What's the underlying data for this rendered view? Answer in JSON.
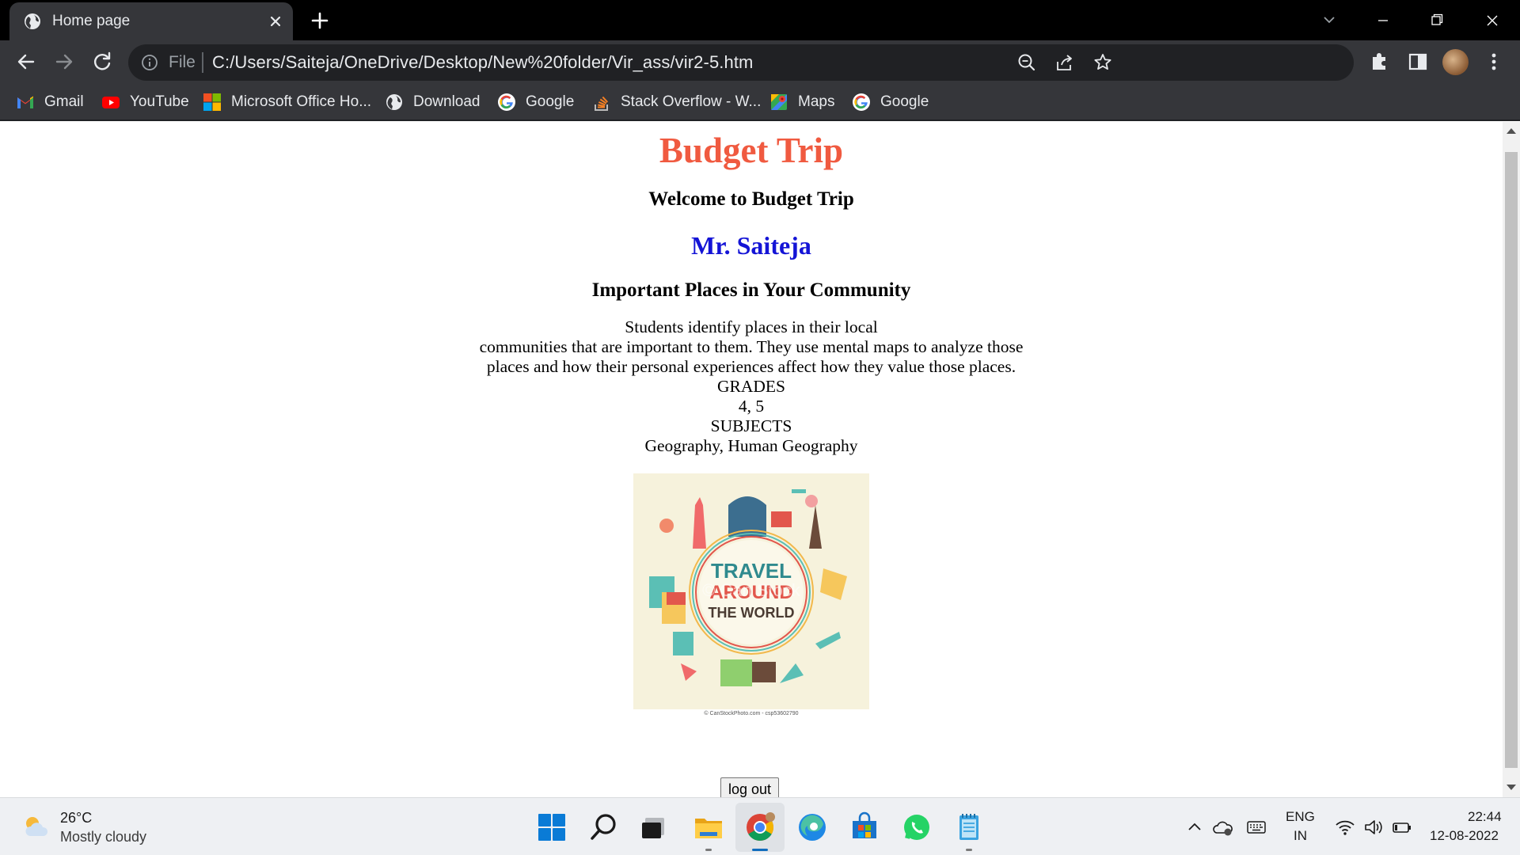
{
  "browser": {
    "tab_title": "Home page",
    "omnibox_scheme": "File",
    "url": "C:/Users/Saiteja/OneDrive/Desktop/New%20folder/Vir_ass/vir2-5.htm",
    "bookmarks": [
      {
        "label": "Gmail",
        "icon": "gmail-icon"
      },
      {
        "label": "YouTube",
        "icon": "youtube-icon"
      },
      {
        "label": "Microsoft Office Ho...",
        "icon": "microsoft-office-icon"
      },
      {
        "label": "Download",
        "icon": "globe-icon"
      },
      {
        "label": "Google",
        "icon": "google-icon"
      },
      {
        "label": "Stack Overflow - W...",
        "icon": "stack-overflow-icon"
      },
      {
        "label": "Maps",
        "icon": "maps-icon"
      },
      {
        "label": "Google",
        "icon": "google-icon"
      }
    ]
  },
  "page": {
    "heading": "Budget Trip",
    "welcome": "Welcome to Budget Trip",
    "name": "Mr. Saiteja",
    "section_title": "Important Places in Your Community",
    "description_lines": [
      "Students identify places in their local",
      "communities that are important to them. They use mental maps to analyze those",
      "places and how their personal experiences affect how they value those places.",
      "GRADES",
      "4, 5",
      "SUBJECTS",
      "Geography, Human Geography"
    ],
    "image": {
      "line1": "TRAVEL",
      "line2": "AROUND",
      "line3": "THE WORLD",
      "watermark": "© Can Stock",
      "credit": "© CanStockPhoto.com - csp53602790"
    },
    "logout_label": "log out"
  },
  "taskbar": {
    "weather_temp": "26°C",
    "weather_desc": "Mostly cloudy",
    "language_line1": "ENG",
    "language_line2": "IN",
    "time": "22:44",
    "date": "12-08-2022"
  },
  "colors": {
    "heading": "#f05a40",
    "name": "#1414d6",
    "chrome_dark": "#35363a",
    "omnibox": "#202124"
  }
}
